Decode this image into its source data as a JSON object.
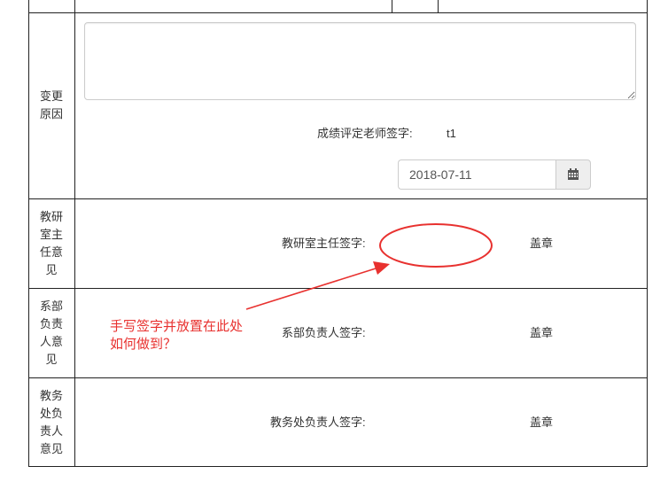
{
  "change_reason": {
    "label_lines": [
      "变更",
      "原因"
    ],
    "textarea_value": "",
    "grading_teacher_label": "成绩评定老师签字:",
    "grading_teacher_value": "t1",
    "date_value": "2018-07-11",
    "calendar_icon": "calendar-icon"
  },
  "section_director": {
    "label_lines": [
      "教研",
      "室主",
      "任意",
      "见"
    ],
    "signature_label": "教研室主任签字:",
    "seal": "盖章"
  },
  "department_head": {
    "label_lines": [
      "系部",
      "负责",
      "人意",
      "见"
    ],
    "signature_label": "系部负责人签字:",
    "seal": "盖章"
  },
  "academic_affairs": {
    "label_lines": [
      "教务",
      "处负",
      "责人",
      "意见"
    ],
    "signature_label": "教务处负责人签字:",
    "seal": "盖章"
  },
  "annotation": {
    "lines": [
      "手写签字并放置在此处",
      "如何做到？"
    ],
    "color": "#e8312f"
  }
}
